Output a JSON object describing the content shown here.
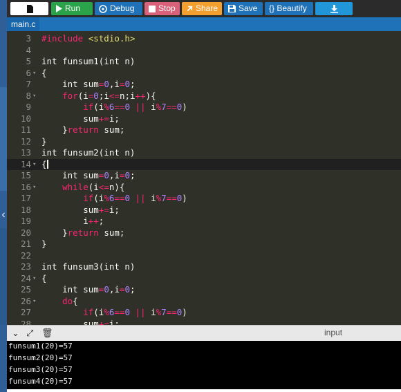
{
  "toolbar": {
    "buttons": [
      {
        "label": "",
        "icon": "file-icon"
      },
      {
        "label": "Run",
        "icon": "play-icon"
      },
      {
        "label": "Debug",
        "icon": "debug-icon"
      },
      {
        "label": "Stop",
        "icon": "stop-icon"
      },
      {
        "label": "Share",
        "icon": "share-icon"
      },
      {
        "label": "Save",
        "icon": "save-icon"
      },
      {
        "label": "{} Beautify",
        "icon": ""
      },
      {
        "label": "",
        "icon": "download-icon"
      }
    ]
  },
  "file_tab": {
    "name": "main.c"
  },
  "editor": {
    "active_line": 14,
    "lines": [
      {
        "n": "3",
        "fold": "",
        "tokens": [
          [
            "pp",
            "#include "
          ],
          [
            "inc",
            "<stdio.h>"
          ]
        ]
      },
      {
        "n": "4",
        "fold": "",
        "tokens": []
      },
      {
        "n": "5",
        "fold": "",
        "tokens": [
          [
            "",
            "int funsum1(int n)"
          ]
        ]
      },
      {
        "n": "6",
        "fold": "▾",
        "tokens": [
          [
            "",
            "{"
          ]
        ]
      },
      {
        "n": "7",
        "fold": "",
        "tokens": [
          [
            "",
            "    int sum"
          ],
          [
            "op",
            "="
          ],
          [
            "num",
            "0"
          ],
          [
            "",
            ",i"
          ],
          [
            "op",
            "="
          ],
          [
            "num",
            "0"
          ],
          [
            "",
            ";"
          ]
        ]
      },
      {
        "n": "8",
        "fold": "▾",
        "tokens": [
          [
            "",
            "    "
          ],
          [
            "kw",
            "for"
          ],
          [
            "",
            "(i"
          ],
          [
            "op",
            "="
          ],
          [
            "num",
            "0"
          ],
          [
            "",
            ";i"
          ],
          [
            "op",
            "<="
          ],
          [
            "",
            "n;i"
          ],
          [
            "op",
            "++"
          ],
          [
            "",
            "){"
          ]
        ]
      },
      {
        "n": "9",
        "fold": "",
        "tokens": [
          [
            "",
            "        "
          ],
          [
            "kw",
            "if"
          ],
          [
            "",
            "(i"
          ],
          [
            "op",
            "%"
          ],
          [
            "num",
            "6"
          ],
          [
            "op",
            "=="
          ],
          [
            "num",
            "0"
          ],
          [
            "op",
            " || "
          ],
          [
            "",
            "i"
          ],
          [
            "op",
            "%"
          ],
          [
            "num",
            "7"
          ],
          [
            "op",
            "=="
          ],
          [
            "num",
            "0"
          ],
          [
            "",
            ")"
          ]
        ]
      },
      {
        "n": "10",
        "fold": "",
        "tokens": [
          [
            "",
            "        sum"
          ],
          [
            "op",
            "+="
          ],
          [
            "",
            "i;"
          ]
        ]
      },
      {
        "n": "11",
        "fold": "",
        "tokens": [
          [
            "",
            "    }"
          ],
          [
            "kw",
            "return"
          ],
          [
            "",
            " sum;"
          ]
        ]
      },
      {
        "n": "12",
        "fold": "",
        "tokens": [
          [
            "",
            "}"
          ]
        ]
      },
      {
        "n": "13",
        "fold": "",
        "tokens": [
          [
            "",
            "int funsum2(int n)"
          ]
        ]
      },
      {
        "n": "14",
        "fold": "▾",
        "tokens": [
          [
            "",
            "{"
          ]
        ],
        "caret": true
      },
      {
        "n": "15",
        "fold": "",
        "tokens": [
          [
            "",
            "    int sum"
          ],
          [
            "op",
            "="
          ],
          [
            "num",
            "0"
          ],
          [
            "",
            ",i"
          ],
          [
            "op",
            "="
          ],
          [
            "num",
            "0"
          ],
          [
            "",
            ";"
          ]
        ]
      },
      {
        "n": "16",
        "fold": "▾",
        "tokens": [
          [
            "",
            "    "
          ],
          [
            "kw",
            "while"
          ],
          [
            "",
            "(i"
          ],
          [
            "op",
            "<="
          ],
          [
            "",
            "n){"
          ]
        ]
      },
      {
        "n": "17",
        "fold": "",
        "tokens": [
          [
            "",
            "        "
          ],
          [
            "kw",
            "if"
          ],
          [
            "",
            "(i"
          ],
          [
            "op",
            "%"
          ],
          [
            "num",
            "6"
          ],
          [
            "op",
            "=="
          ],
          [
            "num",
            "0"
          ],
          [
            "op",
            " || "
          ],
          [
            "",
            "i"
          ],
          [
            "op",
            "%"
          ],
          [
            "num",
            "7"
          ],
          [
            "op",
            "=="
          ],
          [
            "num",
            "0"
          ],
          [
            "",
            ")"
          ]
        ]
      },
      {
        "n": "18",
        "fold": "",
        "tokens": [
          [
            "",
            "        sum"
          ],
          [
            "op",
            "+="
          ],
          [
            "",
            "i;"
          ]
        ]
      },
      {
        "n": "19",
        "fold": "",
        "tokens": [
          [
            "",
            "        i"
          ],
          [
            "op",
            "++"
          ],
          [
            "",
            ";"
          ]
        ]
      },
      {
        "n": "20",
        "fold": "",
        "tokens": [
          [
            "",
            "    }"
          ],
          [
            "kw",
            "return"
          ],
          [
            "",
            " sum;"
          ]
        ]
      },
      {
        "n": "21",
        "fold": "",
        "tokens": [
          [
            "",
            "}"
          ]
        ]
      },
      {
        "n": "22",
        "fold": "",
        "tokens": []
      },
      {
        "n": "23",
        "fold": "",
        "tokens": [
          [
            "",
            "int funsum3(int n)"
          ]
        ]
      },
      {
        "n": "24",
        "fold": "▾",
        "tokens": [
          [
            "",
            "{"
          ]
        ]
      },
      {
        "n": "25",
        "fold": "",
        "tokens": [
          [
            "",
            "    int sum"
          ],
          [
            "op",
            "="
          ],
          [
            "num",
            "0"
          ],
          [
            "",
            ",i"
          ],
          [
            "op",
            "="
          ],
          [
            "num",
            "0"
          ],
          [
            "",
            ";"
          ]
        ]
      },
      {
        "n": "26",
        "fold": "▾",
        "tokens": [
          [
            "",
            "    "
          ],
          [
            "kw",
            "do"
          ],
          [
            "",
            "{"
          ]
        ]
      },
      {
        "n": "27",
        "fold": "",
        "tokens": [
          [
            "",
            "        "
          ],
          [
            "kw",
            "if"
          ],
          [
            "",
            "(i"
          ],
          [
            "op",
            "%"
          ],
          [
            "num",
            "6"
          ],
          [
            "op",
            "=="
          ],
          [
            "num",
            "0"
          ],
          [
            "op",
            " || "
          ],
          [
            "",
            "i"
          ],
          [
            "op",
            "%"
          ],
          [
            "num",
            "7"
          ],
          [
            "op",
            "=="
          ],
          [
            "num",
            "0"
          ],
          [
            "",
            ")"
          ]
        ]
      },
      {
        "n": "28",
        "fold": "",
        "tokens": [
          [
            "",
            "        sum"
          ],
          [
            "op",
            "+="
          ],
          [
            "",
            "i;"
          ]
        ]
      }
    ]
  },
  "output_pane": {
    "input_label": "input",
    "icons": [
      "chevron-down-icon",
      "expand-icon",
      "clear-icon"
    ],
    "console_lines": [
      "funsum1(20)=57",
      "funsum2(20)=57",
      "funsum3(20)=57",
      "funsum4(20)=57"
    ]
  },
  "colors": {
    "run": "#2aa34a",
    "debug": "#1f71b8",
    "stop": "#d9617a",
    "share": "#f4a030",
    "save": "#1f71b8",
    "beautify": "#1f71b8",
    "download": "#2196d8",
    "editor_bg": "#2f3129"
  }
}
